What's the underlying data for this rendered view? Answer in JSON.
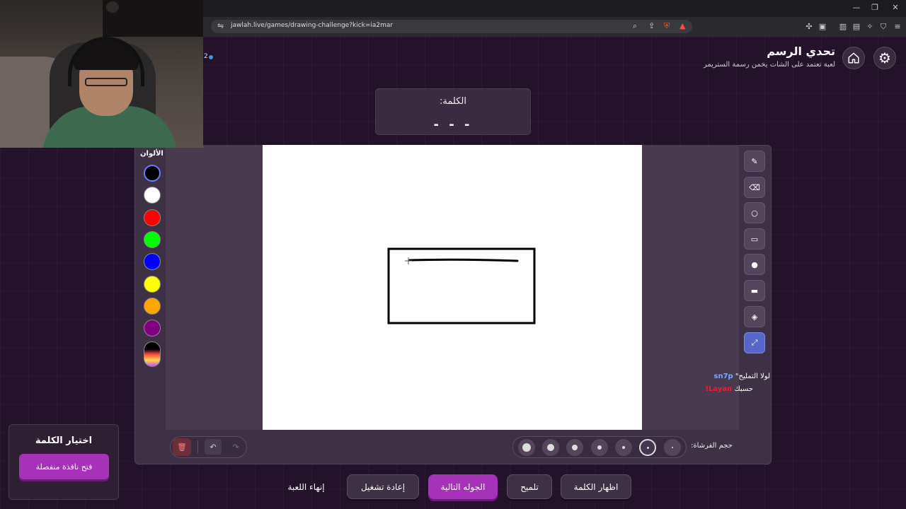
{
  "browser": {
    "url": "jawlah.live/games/drawing-challenge?kick=ia2mar"
  },
  "header": {
    "title": "تحدي الرسم",
    "subtitle": "لعبة تعتمد على الشات يخمن رسمة الستريمر",
    "online_count": "2"
  },
  "word_box": {
    "label": "الكلمة:",
    "hidden_word": "- - -"
  },
  "colors": {
    "title": "الألوان",
    "swatches": [
      "#000000",
      "#ffffff",
      "#ff0000",
      "#00ff00",
      "#0000ff",
      "#ffff00",
      "#ffa500",
      "#800080"
    ],
    "selected": "#000000"
  },
  "tools": [
    "brush-icon",
    "eraser-icon",
    "circle-outline-icon",
    "rectangle-outline-icon",
    "circle-filled-icon",
    "rectangle-filled-icon",
    "fill-bucket-icon",
    "line-icon"
  ],
  "active_tool": "line-icon",
  "brush": {
    "label": "حجم الفرشاة:"
  },
  "chat": [
    {
      "user": "sn7p",
      "message": "لولا التمليح\"",
      "user_color": "#7aa7ff"
    },
    {
      "user": "Layan!",
      "message": "حسبك",
      "user_color": "#e0223a"
    }
  ],
  "word_choice": {
    "title": "اختيار الكلمة",
    "button": "فتح نافذة منفصلة"
  },
  "bottom_buttons": {
    "show_word": "اظهار الكلمة",
    "hint": "تلميح",
    "next_round": "الجوله التالية",
    "restart": "إعادة تشغيل",
    "end_game": "إنهاء اللعبة"
  },
  "accent_color": "#a532b9"
}
